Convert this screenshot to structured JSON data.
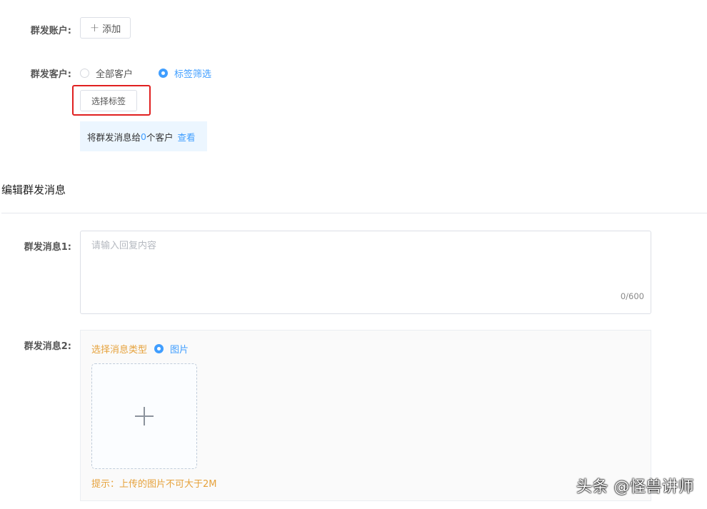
{
  "broadcast_account": {
    "label": "群发账户:",
    "add_button_icon": "plus-icon",
    "add_button_label": "添加"
  },
  "broadcast_customers": {
    "label": "群发客户:",
    "options": [
      {
        "label": "全部客户",
        "checked": false
      },
      {
        "label": "标签筛选",
        "checked": true
      }
    ],
    "select_tag_button": "选择标签",
    "notice_prefix": "将群发消息给",
    "notice_count": "0",
    "notice_suffix": "个客户",
    "notice_link": "查看"
  },
  "edit_section": {
    "title": "编辑群发消息"
  },
  "message1": {
    "label": "群发消息1:",
    "placeholder": "请输入回复内容",
    "value": "",
    "counter": "0/600"
  },
  "message2": {
    "label": "群发消息2:",
    "type_label": "选择消息类型",
    "type_option": {
      "label": "图片",
      "checked": true
    },
    "uploader_icon": "plus-icon",
    "hint": "提示：上传的图片不可大于2M"
  },
  "watermark": "头条 @怪兽讲师",
  "colors": {
    "primary": "#409eff",
    "warning": "#e6a23c",
    "highlight_border": "#e02020",
    "notice_bg": "#ecf6ff"
  }
}
